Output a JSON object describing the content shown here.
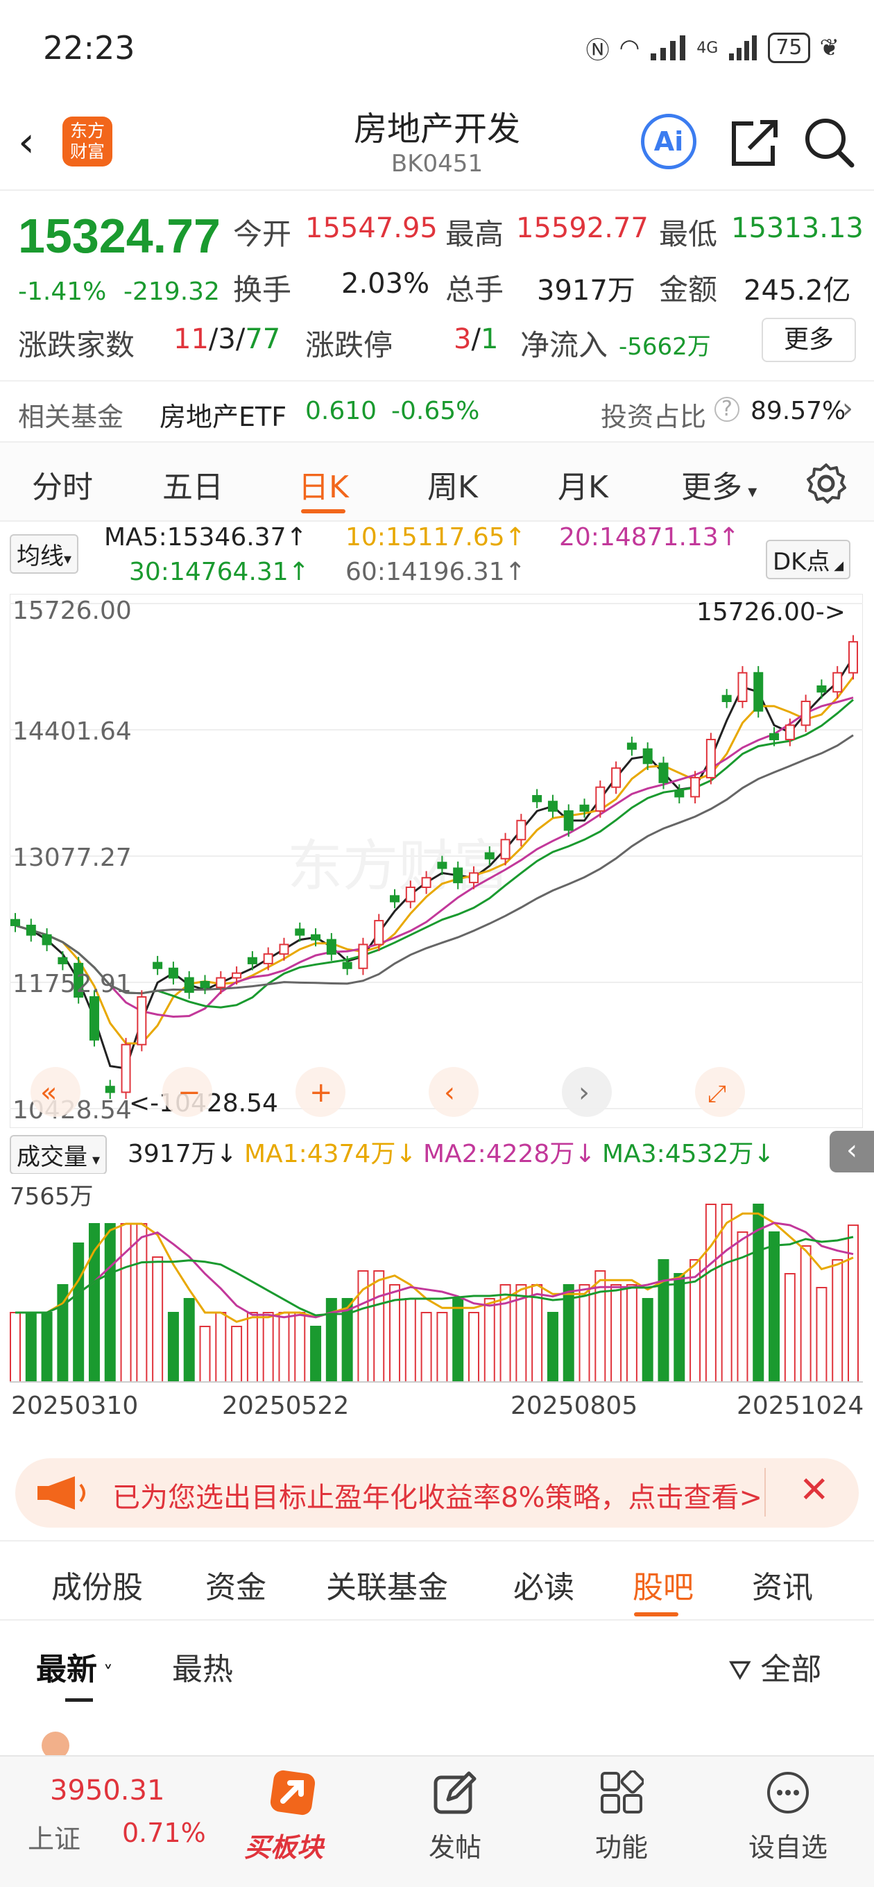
{
  "status_bar": {
    "time": "22:23",
    "network": "4G",
    "battery": "75"
  },
  "header": {
    "back_icon": "chevron-left-icon",
    "logo_text": "东方财富",
    "title": "房地产开发",
    "code": "BK0451",
    "ai_label": "Ai",
    "share_icon": "share-icon",
    "search_icon": "search-icon"
  },
  "quote": {
    "price": "15324.77",
    "change_pct": "-1.41%",
    "change": "-219.32",
    "open_label": "今开",
    "open": "15547.95",
    "high_label": "最高",
    "high": "15592.77",
    "low_label": "最低",
    "low": "15313.13",
    "turnover_label": "换手",
    "turnover": "2.03%",
    "volume_label": "总手",
    "volume": "3917万",
    "amount_label": "金额",
    "amount": "245.2亿",
    "breadth_label": "涨跌家数",
    "breadth_up": "11",
    "breadth_flat": "3",
    "breadth_down": "77",
    "sep": "/",
    "limit_label": "涨跌停",
    "limit_up": "3",
    "limit_down": "1",
    "netflow_label": "净流入",
    "netflow": "-5662万",
    "more_label": "更多"
  },
  "fund": {
    "label": "相关基金",
    "name": "房地产ETF",
    "price": "0.610",
    "pct": "-0.65%",
    "ratio_label": "投资占比",
    "ratio": "89.57%"
  },
  "chart_tabs": [
    "分时",
    "五日",
    "日K",
    "周K",
    "月K",
    "更多"
  ],
  "chart_tabs_active": 2,
  "ma": {
    "selector": "均线",
    "ma5": "MA5:15346.37↑",
    "ma10": "10:15117.65↑",
    "ma20": "20:14871.13↑",
    "ma30": "30:14764.31↑",
    "ma60": "60:14196.31↑",
    "dk": "DK点"
  },
  "chart_labels": {
    "max_marker": "15726.00->",
    "min_marker": "<-10428.54"
  },
  "volume": {
    "selector": "成交量",
    "current": "3917万↓",
    "ma1": "MA1:4374万↓",
    "ma2": "MA2:4228万↓",
    "ma3": "MA3:4532万↓",
    "axis_max": "7565万"
  },
  "colors": {
    "up": "#e0343c",
    "down": "#1a9a2f",
    "ma5": "#222222",
    "ma10": "#e8a800",
    "ma20": "#c2389a",
    "ma30": "#1a9a2f",
    "ma60": "#666666",
    "accent": "#f2661b"
  },
  "chart_data": {
    "type": "candlestick",
    "y_ticks": [
      "15726.00",
      "14401.64",
      "13077.27",
      "11752.91",
      "10428.54"
    ],
    "ylim": [
      10428.54,
      15726.0
    ],
    "x_ticks": [
      "20250310",
      "20250522",
      "20250805",
      "20251024"
    ],
    "series": [
      {
        "name": "MA5",
        "last": 15346.37
      },
      {
        "name": "10",
        "last": 15117.65
      },
      {
        "name": "20",
        "last": 14871.13
      },
      {
        "name": "30",
        "last": 14764.31
      },
      {
        "name": "60",
        "last": 14196.31
      }
    ],
    "close_trend": [
      12350,
      12250,
      12150,
      11950,
      11600,
      11150,
      10600,
      11100,
      11600,
      11900,
      11800,
      11650,
      11700,
      11800,
      11850,
      11950,
      12050,
      12150,
      12250,
      12200,
      12050,
      11900,
      12150,
      12400,
      12600,
      12750,
      12850,
      12950,
      12800,
      12900,
      13050,
      13250,
      13450,
      13650,
      13550,
      13350,
      13550,
      13800,
      14000,
      14200,
      14050,
      13850,
      13700,
      13900,
      14300,
      14700,
      15000,
      14600,
      14300,
      14450,
      14700,
      14800,
      15000,
      15324.77
    ]
  },
  "promo": {
    "text": "已为您选出目标止盈年化收益率8%策略，点击查看",
    "arrow": ">",
    "close_icon": "close-icon"
  },
  "info_tabs": [
    "成份股",
    "资金",
    "关联基金",
    "必读",
    "股吧",
    "资讯"
  ],
  "info_tabs_active": 4,
  "sort": {
    "latest": "最新",
    "hot": "最热",
    "filter": "全部"
  },
  "bottom_nav": {
    "index_value": "3950.31",
    "index_name": "上证",
    "index_pct": "0.71%",
    "buy_block": "买板块",
    "post": "发帖",
    "function": "功能",
    "watchlist": "设自选"
  }
}
